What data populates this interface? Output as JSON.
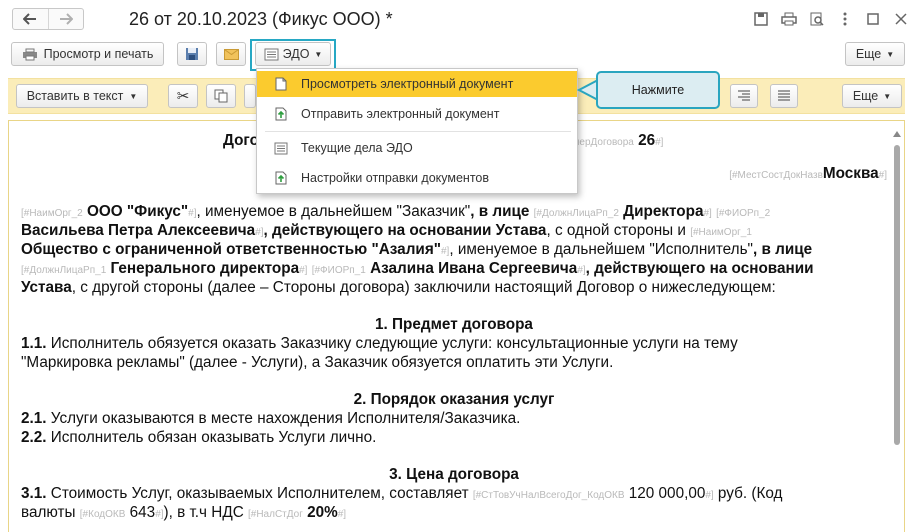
{
  "window": {
    "title": "26 от 20.10.2023 (Фикус ООО) *",
    "back_icon": "arrow-left-icon",
    "forward_icon": "arrow-right-icon"
  },
  "toolbar1": {
    "print_preview_label": "Просмотр и печать",
    "edo_label": "ЭДО",
    "more_label": "Еще"
  },
  "toolbar2": {
    "insert_text_label": "Вставить в текст",
    "more_label": "Еще"
  },
  "edo_menu": {
    "items": [
      {
        "label": "Просмотреть электронный документ",
        "icon": "document-icon"
      },
      {
        "label": "Отправить электронный документ",
        "icon": "send-document-icon"
      },
      {
        "label": "Текущие дела ЭДО",
        "icon": "edo-tasks-icon"
      },
      {
        "label": "Настройки отправки документов",
        "icon": "send-settings-icon"
      }
    ]
  },
  "callout": {
    "text": "Нажмите"
  },
  "document": {
    "title_visible": "Дого",
    "tag_contract_num": "омерДоговора",
    "contract_num": "26",
    "tag_place": "[#МестСостДокНазв",
    "place": "Москва",
    "p1": {
      "tag_org2": "[#НаимОрг_2",
      "org2": "ООО \"Фикус\"",
      "t1": ", именуемое в дальнейшем \"Заказчик\"",
      "t2": ", в лице",
      "tag_pos2": "[#ДолжнЛицаРп_2",
      "pos2": "Директора",
      "tag_fio2": "[#ФИОРп_2",
      "fio2": "Васильева Петра Алексеевича",
      "t3": ", действующего на основании Устава",
      "t4": ", с одной стороны и",
      "tag_org1": "[#НаимОрг_1",
      "org1": "Общество с ограниченной ответственностью \"Азалия\"",
      "t5": ", именуемое в дальнейшем \"Исполнитель\"",
      "t6": ", в лице",
      "tag_pos1": "[#ДолжнЛицаРп_1",
      "pos1": "Генерального директора",
      "tag_fio1": "[#ФИОРп_1",
      "fio1": "Азалина Ивана Сергеевича",
      "t7": ", действующего на основании",
      "t8": "Устава",
      "t9": ", с другой стороны (далее – Стороны договора) заключили настоящий Договор о нижеследующем:"
    },
    "s1_title": "1. Предмет договора",
    "s1_1_num": "1.1.",
    "s1_1_a": " Исполнитель обязуется оказать Заказчику следующие услуги: консультационные услуги на тему",
    "s1_1_b": "\"Маркировка рекламы\" (далее - Услуги), а Заказчик обязуется оплатить эти Услуги.",
    "s2_title": "2. Порядок оказания услуг",
    "s2_1_num": "2.1.",
    "s2_1": " Услуги оказываются в месте нахождения Исполнителя/Заказчика.",
    "s2_2_num": "2.2.",
    "s2_2": " Исполнитель обязан оказывать Услуги лично.",
    "s3_title": "3. Цена договора",
    "s3_1_num": "3.1.",
    "s3_1_a": " Стоимость Услуг, оказываемых Исполнителем, составляет ",
    "tag_sum": "[#СтТовУчНалВсегоДог_КодОКВ",
    "sum": "120 000,00",
    "s3_1_b": " руб. (Код",
    "s3_1_c": "валюты ",
    "tag_okv": "[#КодОКВ",
    "okv": "643",
    "s3_1_d": "), в т.ч НДС ",
    "tag_nds": "[#НалСтДог",
    "nds": "20%",
    "tag_end": "#]"
  },
  "colors": {
    "accent_highlight": "#27a8c4",
    "menu_active": "#fbcb2e",
    "toolbar_yellow": "#fbedb9"
  }
}
